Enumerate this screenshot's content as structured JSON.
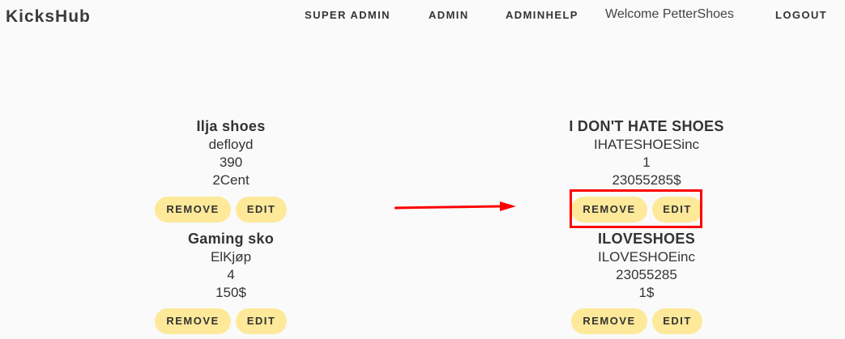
{
  "header": {
    "brand": "KicksHub",
    "nav": {
      "super_admin": "SUPER ADMIN",
      "admin": "ADMIN",
      "adminhelp": "ADMINHELP",
      "welcome": "Welcome PetterShoes",
      "logout": "LOGOUT"
    }
  },
  "buttons": {
    "remove": "REMOVE",
    "edit": "EDIT"
  },
  "products": [
    {
      "name": "Ilja shoes",
      "brand": "defloyd",
      "quantity": "390",
      "price": "2Cent"
    },
    {
      "name": "I DON'T HATE SHOES",
      "brand": "IHATESHOESinc",
      "quantity": "1",
      "price": "23055285$"
    },
    {
      "name": "Gaming sko",
      "brand": "ElKjøp",
      "quantity": "4",
      "price": "150$"
    },
    {
      "name": "ILOVESHOES",
      "brand": "ILOVESHOEinc",
      "quantity": "23055285",
      "price": "1$"
    }
  ],
  "annotation": {
    "highlight_color": "#ff0000",
    "arrow_color": "#ff0000"
  },
  "colors": {
    "button_bg": "#fde999",
    "background": "#fafafa"
  }
}
